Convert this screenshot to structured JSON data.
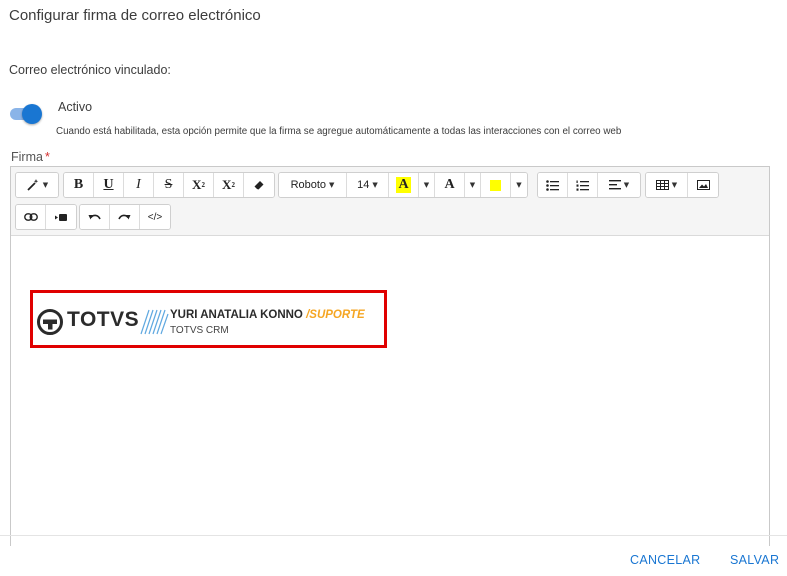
{
  "dialog": {
    "title": "Configurar firma de correo electrónico"
  },
  "linked_email": {
    "label": "Correo electrónico vinculado:"
  },
  "active_toggle": {
    "label": "Activo",
    "checked": true,
    "hint": "Cuando está habilitada, esta opción permite que la firma se agregue automáticamente a todas las interacciones con el correo web"
  },
  "signature_field": {
    "label": "Firma",
    "required_mark": "*"
  },
  "toolbar": {
    "font_family": "Roboto",
    "font_size": "14",
    "font_color_letter": "A",
    "highlight_letter": "A",
    "code_label": "</>",
    "highlight_color": "#ffff00"
  },
  "signature": {
    "logo_text": "TOTVS",
    "name": "YURI ANATALIA KONNO",
    "department": "/SUPORTE",
    "company": "TOTVS CRM"
  },
  "footer": {
    "cancel": "CANCELAR",
    "save": "SALVAR"
  },
  "colors": {
    "primary": "#1976d2",
    "accent_orange": "#f5a623",
    "highlight_border": "#e00000"
  }
}
